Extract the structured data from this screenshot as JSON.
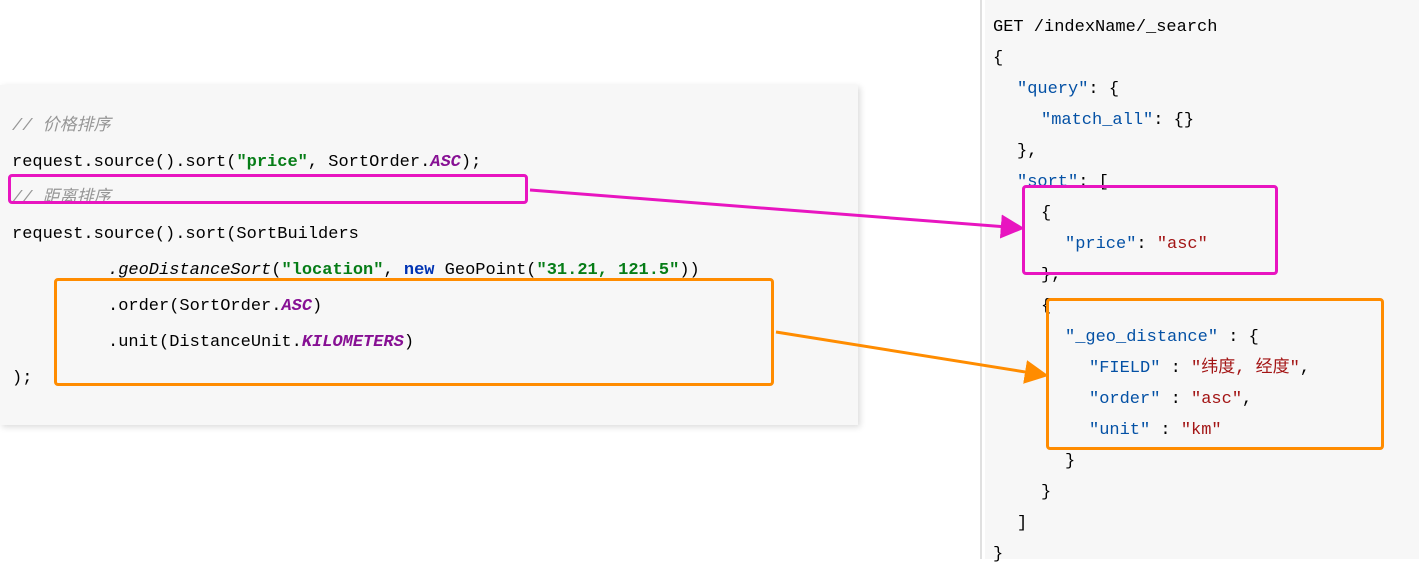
{
  "java": {
    "comment_price": "// 价格排序",
    "line_price_1": "request.source().sort(",
    "line_price_str": "\"price\"",
    "line_price_2": ", SortOrder.",
    "line_price_enum": "ASC",
    "line_price_3": ");",
    "comment_distance": "// 距离排序",
    "line_dist_1": "request.source().sort(SortBuilders",
    "geo_method": ".geoDistanceSort",
    "geo_paren_open": "(",
    "geo_loc_str": "\"location\"",
    "geo_comma": ", ",
    "geo_new": "new",
    "geo_class": " GeoPoint(",
    "geo_point_str": "\"31.21, 121.5\"",
    "geo_close": "))",
    "order_call": ".order(SortOrder.",
    "order_enum": "ASC",
    "order_close": ")",
    "unit_call": ".unit(DistanceUnit.",
    "unit_enum": "KILOMETERS",
    "unit_close": ")",
    "end": ");"
  },
  "json": {
    "line1": "GET /indexName/_search",
    "lbrace": "{",
    "rbrace": "}",
    "lbracket": "[",
    "rbracket": "]",
    "query_key": "\"query\"",
    "match_all_key": "\"match_all\"",
    "sort_key": "\"sort\"",
    "price_key": "\"price\"",
    "price_val": "\"asc\"",
    "geo_key": "\"_geo_distance\"",
    "field_key": "\"FIELD\"",
    "field_val": "\"纬度, 经度\"",
    "order_key": "\"order\"",
    "order_val": "\"asc\"",
    "unit_key": "\"unit\"",
    "unit_val": "\"km\"",
    "colon": ": ",
    "colon_sp": " : ",
    "comma": ",",
    "empty_obj": "{}"
  }
}
